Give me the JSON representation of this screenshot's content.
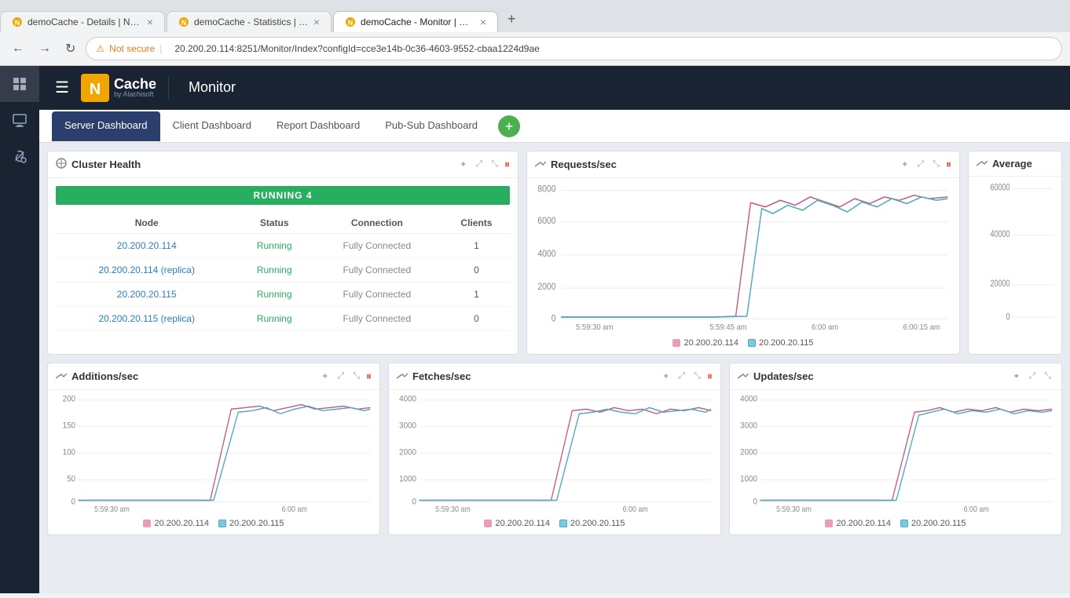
{
  "browser": {
    "tabs": [
      {
        "id": "tab1",
        "title": "demoCache - Details | NCache",
        "active": false
      },
      {
        "id": "tab2",
        "title": "demoCache - Statistics | NCache",
        "active": false
      },
      {
        "id": "tab3",
        "title": "demoCache - Monitor | NCache",
        "active": true
      }
    ],
    "address": "20.200.20.114:8251/Monitor/Index?configId=cce3e14b-0c36-4603-9552-cbaa1224d9ae",
    "security_label": "Not secure",
    "new_tab_label": "+"
  },
  "app": {
    "title": "Monitor",
    "logo_n": "N",
    "logo_cache": "Cache",
    "logo_sub": "by Alachisoft"
  },
  "sidebar": {
    "icons": [
      {
        "id": "grid-icon",
        "symbol": "⊞",
        "active": true
      },
      {
        "id": "monitor-icon",
        "symbol": "▣",
        "active": false
      },
      {
        "id": "tools-icon",
        "symbol": "✦",
        "active": false
      }
    ]
  },
  "dashboard_tabs": [
    {
      "id": "server",
      "label": "Server Dashboard",
      "active": true
    },
    {
      "id": "client",
      "label": "Client Dashboard",
      "active": false
    },
    {
      "id": "report",
      "label": "Report Dashboard",
      "active": false
    },
    {
      "id": "pubsub",
      "label": "Pub-Sub Dashboard",
      "active": false
    }
  ],
  "cluster_health": {
    "title": "Cluster Health",
    "badge": "RUNNING 4",
    "columns": [
      "Node",
      "Status",
      "Connection",
      "Clients"
    ],
    "rows": [
      {
        "node": "20.200.20.114",
        "status": "Running",
        "connection": "Fully Connected",
        "clients": "1"
      },
      {
        "node": "20.200.20.114 (replica)",
        "status": "Running",
        "connection": "Fully Connected",
        "clients": "0"
      },
      {
        "node": "20.200.20.115",
        "status": "Running",
        "connection": "Fully Connected",
        "clients": "1"
      },
      {
        "node": "20.200.20.115 (replica)",
        "status": "Running",
        "connection": "Fully Connected",
        "clients": "0"
      }
    ]
  },
  "requests_chart": {
    "title": "Requests/sec",
    "y_labels": [
      "8000",
      "6000",
      "4000",
      "2000",
      "0"
    ],
    "x_labels": [
      "5:59:30 am",
      "5:59:45 am",
      "6:00 am",
      "6:00:15 am"
    ],
    "legend": [
      {
        "label": "20.200.20.114",
        "color": "#e8a0b0"
      },
      {
        "label": "20.200.20.115",
        "color": "#80c8d8"
      }
    ]
  },
  "average_chart": {
    "title": "Average",
    "y_labels": [
      "60000",
      "40000",
      "20000",
      "0"
    ],
    "truncated": true
  },
  "additions_chart": {
    "title": "Additions/sec",
    "y_labels": [
      "200",
      "150",
      "100",
      "50",
      "0"
    ],
    "x_labels": [
      "5:59:30 am",
      "6:00 am"
    ],
    "legend": [
      {
        "label": "20.200.20.114",
        "color": "#e8a0b0"
      },
      {
        "label": "20.200.20.115",
        "color": "#80c8d8"
      }
    ]
  },
  "fetches_chart": {
    "title": "Fetches/sec",
    "y_labels": [
      "4000",
      "3000",
      "2000",
      "1000",
      "0"
    ],
    "x_labels": [
      "5:59:30 am",
      "6:00 am"
    ],
    "legend": [
      {
        "label": "20.200.20.114",
        "color": "#e8a0b0"
      },
      {
        "label": "20.200.20.115",
        "color": "#80c8d8"
      }
    ]
  },
  "updates_chart": {
    "title": "Updates/sec",
    "y_labels": [
      "4000",
      "3000",
      "2000",
      "1000",
      "0"
    ],
    "x_labels": [
      "5:59:30 am",
      "6:00 am"
    ],
    "legend": [
      {
        "label": "20.200.20.114",
        "color": "#e8a0b0"
      },
      {
        "label": "20.200.20.115",
        "color": "#80c8d8"
      }
    ]
  },
  "colors": {
    "sidebar_bg": "#1a2332",
    "topbar_bg": "#1a2332",
    "active_tab_bg": "#2c3e6b",
    "running_badge": "#27ae60",
    "node_link": "#2980b9",
    "status_running": "#27ae60",
    "add_btn": "#4CAF50",
    "chart_line1": "#c0607a",
    "chart_line2": "#50a8c0",
    "pause_color": "#e74c3c"
  }
}
